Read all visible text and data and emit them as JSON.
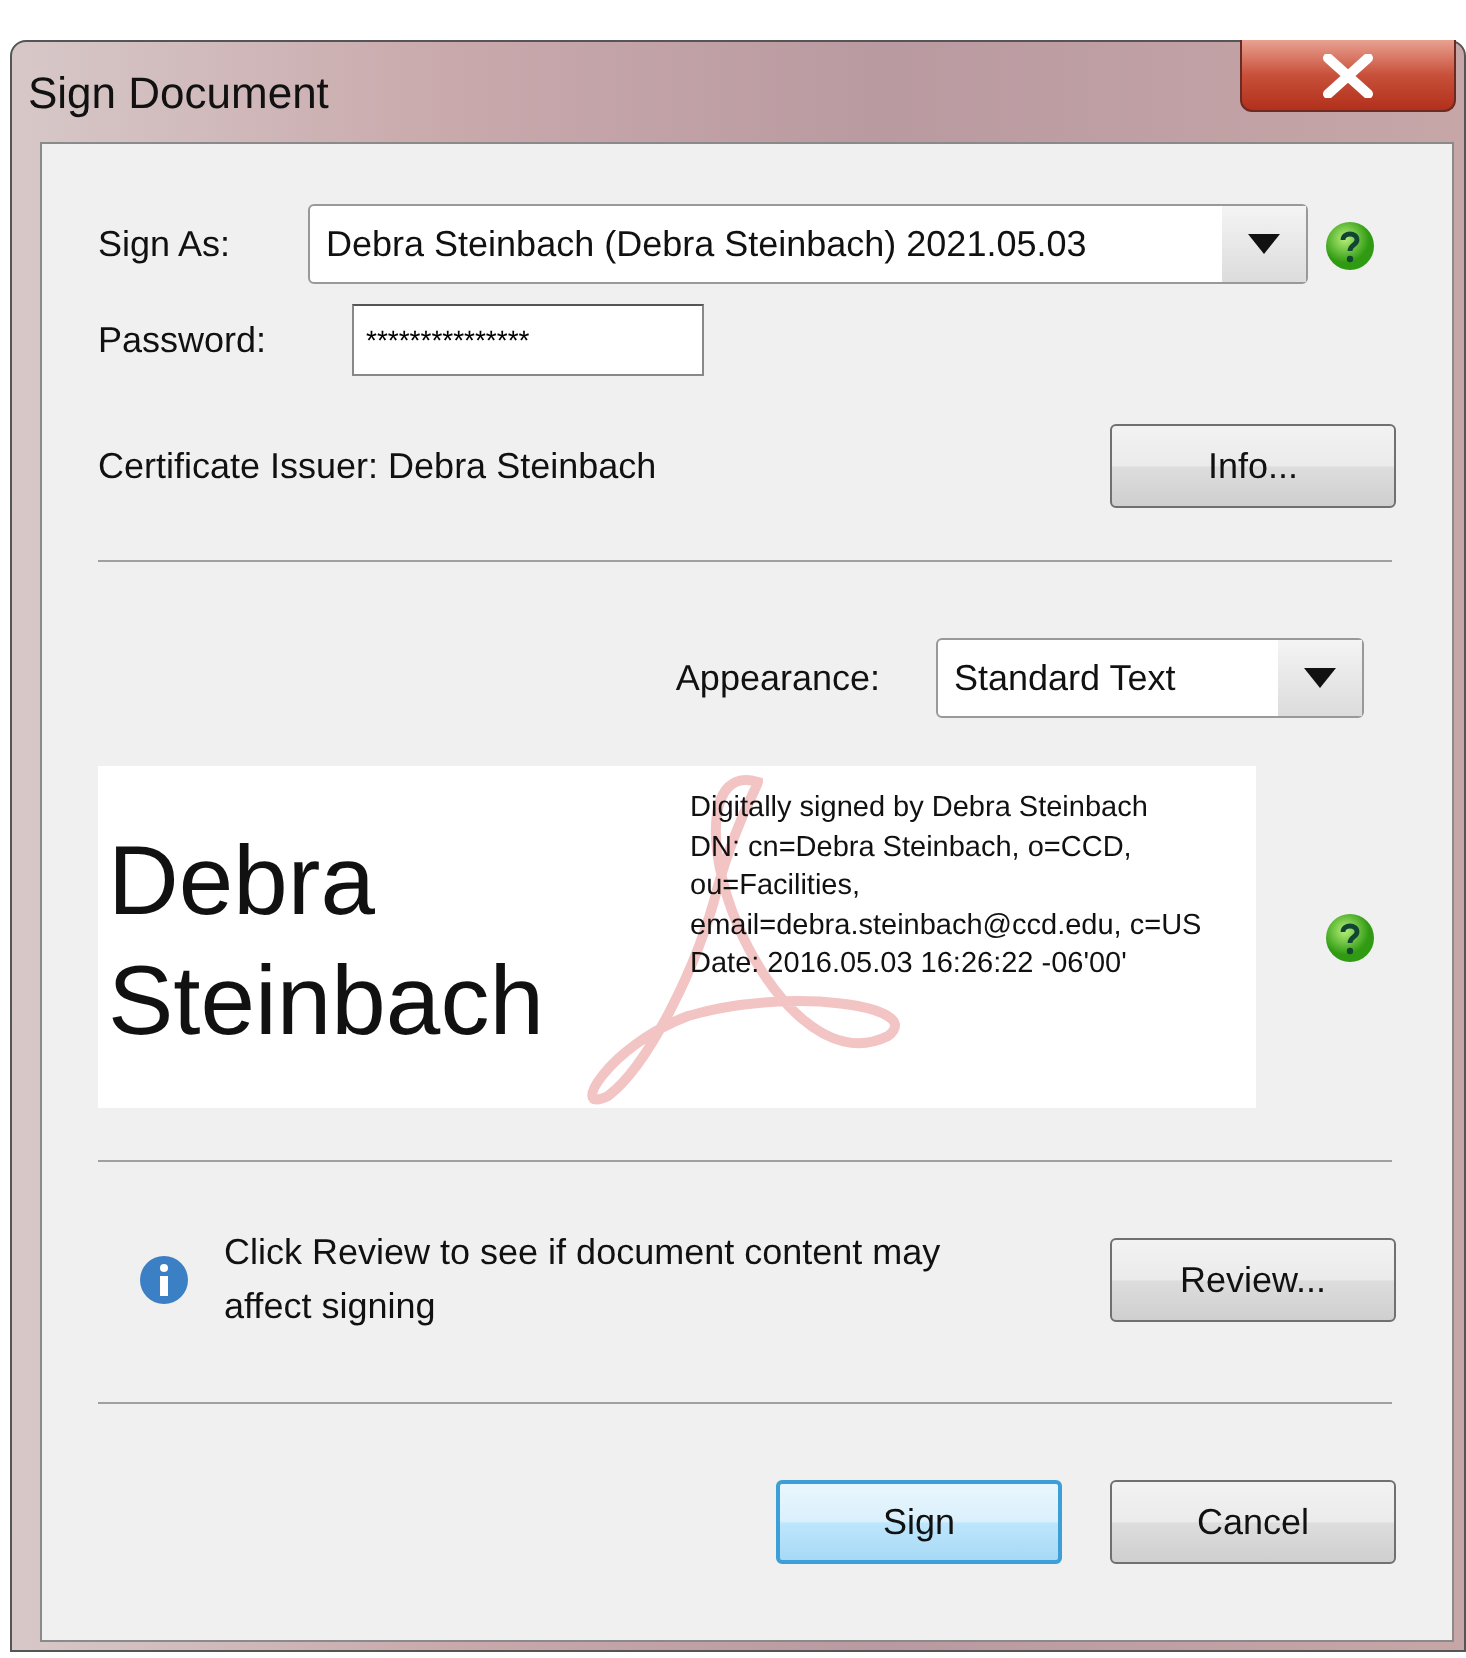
{
  "window": {
    "title": "Sign Document"
  },
  "sign_as": {
    "label": "Sign As:",
    "value": "Debra Steinbach (Debra Steinbach) 2021.05.03"
  },
  "password": {
    "label": "Password:",
    "value": "***************"
  },
  "certificate_issuer": "Certificate Issuer: Debra Steinbach",
  "info_button": "Info...",
  "appearance": {
    "label": "Appearance:",
    "value": "Standard Text"
  },
  "preview": {
    "name": "Debra Steinbach",
    "details": [
      "Digitally signed by Debra Steinbach",
      "DN: cn=Debra Steinbach, o=CCD, ou=Facilities, email=debra.steinbach@ccd.edu, c=US",
      "Date: 2016.05.03 16:26:22 -06'00'"
    ]
  },
  "review": {
    "message": "Click Review to see if document content may affect signing",
    "button": "Review..."
  },
  "buttons": [
    {
      "label": "Sign",
      "default": true
    },
    {
      "label": "Cancel",
      "default": false
    }
  ]
}
